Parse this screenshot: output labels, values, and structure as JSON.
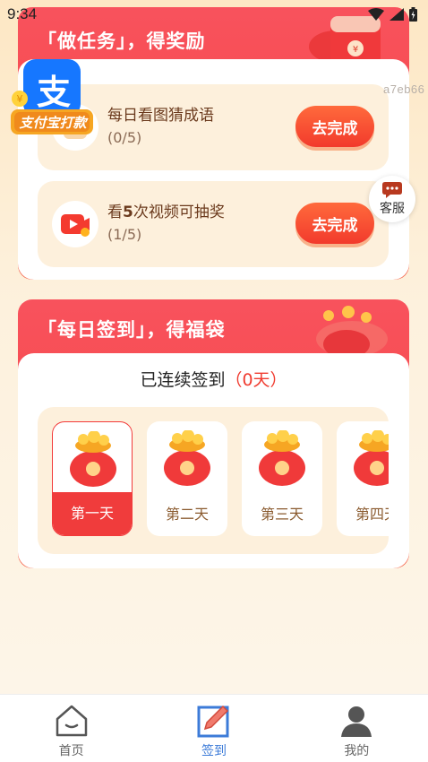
{
  "status_bar": {
    "time": "9:34"
  },
  "watermark": "a7eb66",
  "alipay_badge": {
    "logo_char": "支",
    "label": "支付宝打款"
  },
  "task_section": {
    "title": "「做任务」，得奖励",
    "tasks": [
      {
        "name": "每日看图猜成语",
        "progress": "(0/5)",
        "button": "去完成",
        "icon": "idiom-icon"
      },
      {
        "name_prefix": "看",
        "name_bold": "5",
        "name_suffix": "次视频可抽奖",
        "progress": "(1/5)",
        "button": "去完成",
        "icon": "video-play-icon"
      }
    ]
  },
  "customer_service": {
    "label": "客服"
  },
  "sign_section": {
    "title": "「每日签到」，得福袋",
    "streak_prefix": "已连续签到",
    "streak_count": "（0天）",
    "days": [
      {
        "label": "第一天",
        "active": true
      },
      {
        "label": "第二天",
        "active": false
      },
      {
        "label": "第三天",
        "active": false
      },
      {
        "label": "第四天",
        "active": false
      }
    ]
  },
  "bottom_nav": {
    "items": [
      {
        "label": "首页",
        "icon": "home-icon",
        "active": false
      },
      {
        "label": "签到",
        "icon": "sign-in-icon",
        "active": true
      },
      {
        "label": "我的",
        "icon": "user-icon",
        "active": false
      }
    ]
  },
  "colors": {
    "accent_red": "#f03b2f",
    "nav_active": "#3c7bd8",
    "task_bg": "#fdf0dc"
  }
}
